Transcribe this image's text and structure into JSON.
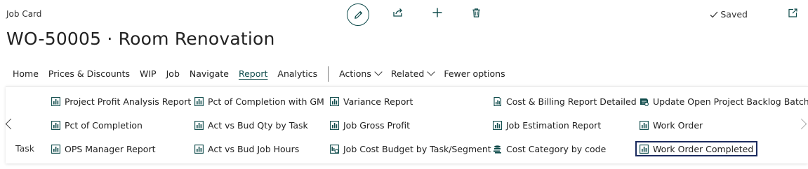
{
  "header": {
    "page_type": "Job Card",
    "title": "WO-50005 · Room Renovation",
    "status": "Saved"
  },
  "icons": {
    "edit": "pencil-icon",
    "share": "share-icon",
    "new": "plus-icon",
    "delete": "trash-icon",
    "status": "checkmark-icon",
    "popout": "popout-icon"
  },
  "colors": {
    "accent": "#0f4b4b",
    "selected_border": "#1a2a5e"
  },
  "nav": {
    "items": [
      "Home",
      "Prices & Discounts",
      "WIP",
      "Job",
      "Navigate",
      "Report",
      "Analytics"
    ],
    "active": "Report",
    "menus": [
      "Actions",
      "Related"
    ],
    "fewer": "Fewer options"
  },
  "report_panel": {
    "row_label": "Task",
    "columns": [
      [
        "Project Profit Analysis Report",
        "Pct of Completion",
        "OPS Manager Report"
      ],
      [
        "Pct of Completion with GM",
        "Act vs Bud Qty by Task",
        "Act vs Bud Job Hours"
      ],
      [
        "Variance Report",
        "Job Gross Profit",
        "Job Cost Budget by Task/Segment"
      ],
      [
        "Cost & Billing Report Detailed",
        "Job Estimation Report",
        "Cost Category by code"
      ],
      [
        "Update Open Project Backlog Batch",
        "Work Order",
        "Work Order Completed"
      ]
    ],
    "selected": "Work Order Completed"
  }
}
